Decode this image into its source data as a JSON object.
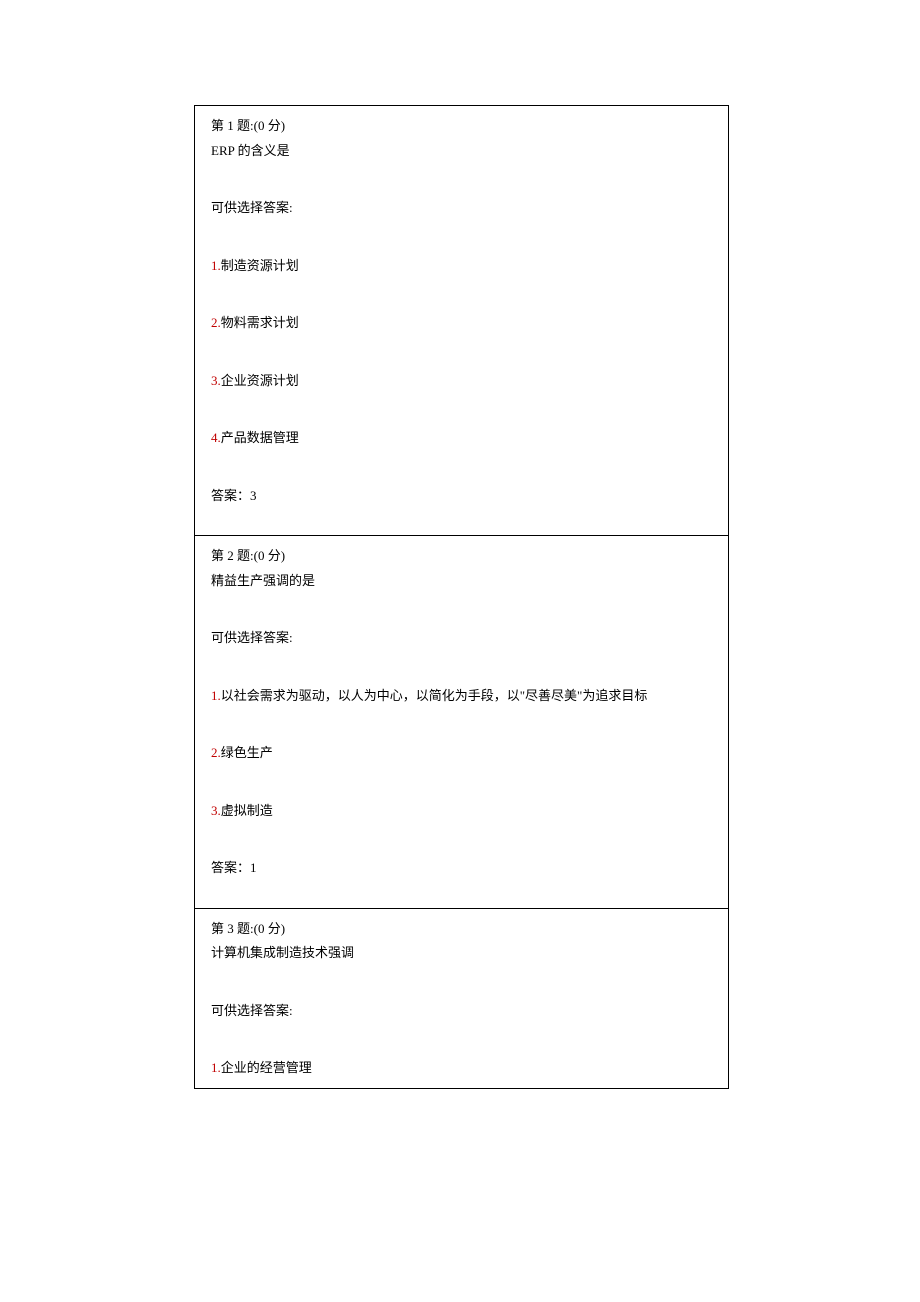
{
  "questions": [
    {
      "header_prefix": "第 ",
      "number": "1",
      "header_suffix": " 题:(0 分)",
      "text": "ERP 的含义是",
      "available_label": "可供选择答案:",
      "options": [
        {
          "num": "1.",
          "text": "制造资源计划"
        },
        {
          "num": "2.",
          "text": "物料需求计划"
        },
        {
          "num": "3.",
          "text": "企业资源计划"
        },
        {
          "num": "4.",
          "text": "产品数据管理"
        }
      ],
      "answer_label": "答案：",
      "answer_value": "3"
    },
    {
      "header_prefix": "第 ",
      "number": "2",
      "header_suffix": " 题:(0 分)",
      "text": "精益生产强调的是",
      "available_label": "可供选择答案:",
      "options": [
        {
          "num": "1.",
          "text": "以社会需求为驱动，以人为中心，以简化为手段，以\"尽善尽美\"为追求目标"
        },
        {
          "num": "2.",
          "text": "绿色生产"
        },
        {
          "num": "3.",
          "text": "虚拟制造"
        }
      ],
      "answer_label": "答案：",
      "answer_value": "1"
    },
    {
      "header_prefix": "第 ",
      "number": "3",
      "header_suffix": " 题:(0 分)",
      "text": "计算机集成制造技术强调",
      "available_label": "可供选择答案:",
      "options": [
        {
          "num": "1.",
          "text": "企业的经营管理"
        }
      ]
    }
  ]
}
